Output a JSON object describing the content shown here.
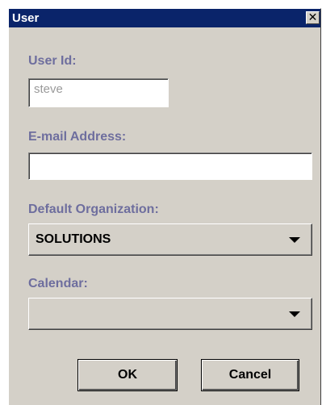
{
  "window": {
    "title": "User",
    "close_label": "✕"
  },
  "user_id": {
    "label": "User Id:",
    "value": "steve"
  },
  "email": {
    "label": "E-mail Address:",
    "value": ""
  },
  "default_organization": {
    "label": "Default Organization:",
    "selected": "SOLUTIONS"
  },
  "calendar": {
    "label": "Calendar:",
    "selected": ""
  },
  "buttons": {
    "ok": "OK",
    "cancel": "Cancel"
  }
}
